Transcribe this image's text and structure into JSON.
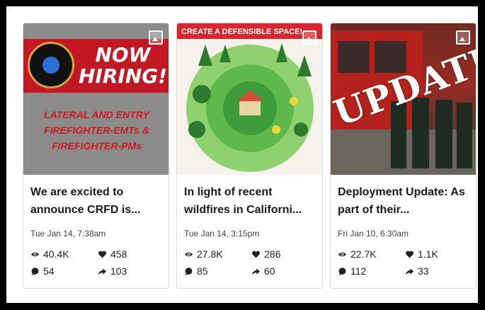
{
  "cards": [
    {
      "title": "We are excited to announce CRFD is...",
      "date": "Tue Jan 14, 7:38am",
      "views": "40.4K",
      "likes": "458",
      "comments": "54",
      "shares": "103",
      "image_text": {
        "headline": "NOW HIRING!",
        "subtext": "LATERAL AND ENTRY FIREFIGHTER-EMTs & FIREFIGHTER-PMs"
      }
    },
    {
      "title": "In light of recent wildfires in Californi...",
      "date": "Tue Jan 14, 3:15pm",
      "views": "27.8K",
      "likes": "286",
      "comments": "85",
      "shares": "60",
      "image_text": {
        "headline": "CREATE A DEFENSIBLE SPACE!"
      }
    },
    {
      "title": "Deployment Update: As part of their...",
      "date": "Fri Jan 10, 6:30am",
      "views": "22.7K",
      "likes": "1.1K",
      "comments": "112",
      "shares": "33",
      "image_text": {
        "headline": "UPDATE"
      }
    }
  ],
  "icons": {
    "views": "eye-icon",
    "likes": "heart-icon",
    "comments": "comment-icon",
    "shares": "share-arrow-icon",
    "gallery": "gallery-icon"
  },
  "colors": {
    "hiring_red": "#c21823",
    "defensible_green": "#5fb84a",
    "text_dark": "#1a1a1a"
  }
}
